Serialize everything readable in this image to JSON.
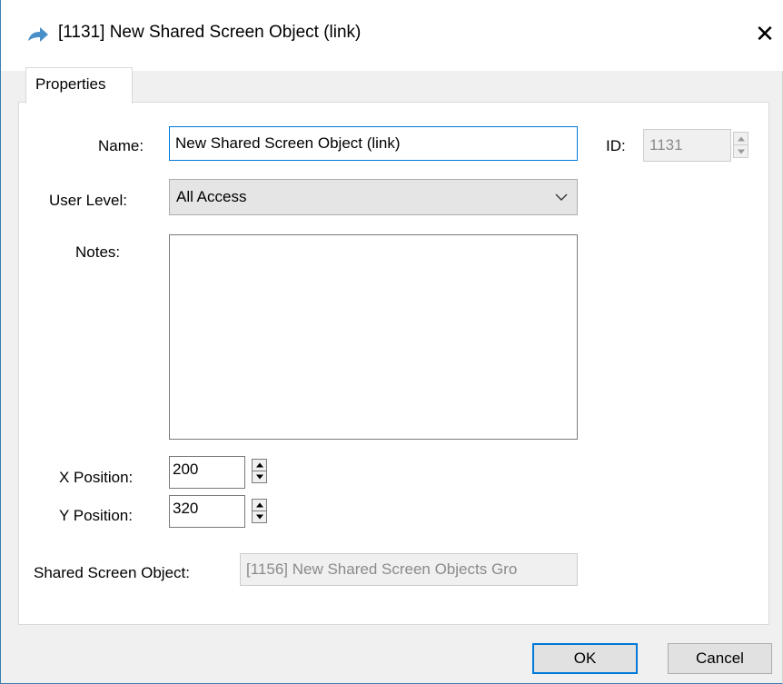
{
  "window": {
    "title": "[1131] New Shared Screen Object (link)",
    "icon": "arrow-right-icon",
    "close_glyph": "✕"
  },
  "tabs": [
    {
      "label": "Properties",
      "selected": true
    }
  ],
  "form": {
    "name_label": "Name:",
    "name_value": "New Shared Screen Object (link)",
    "id_label": "ID:",
    "id_value": "1131",
    "user_level_label": "User Level:",
    "user_level_value": "All Access",
    "notes_label": "Notes:",
    "notes_value": "",
    "x_position_label": "X Position:",
    "x_position_value": "200",
    "y_position_label": "Y Position:",
    "y_position_value": "320",
    "shared_object_label": "Shared Screen Object:",
    "shared_object_value": "[1156] New Shared Screen Objects Gro"
  },
  "buttons": {
    "ok_label": "OK",
    "cancel_label": "Cancel"
  },
  "colors": {
    "accent": "#0078d7",
    "icon": "#4a90c8"
  }
}
